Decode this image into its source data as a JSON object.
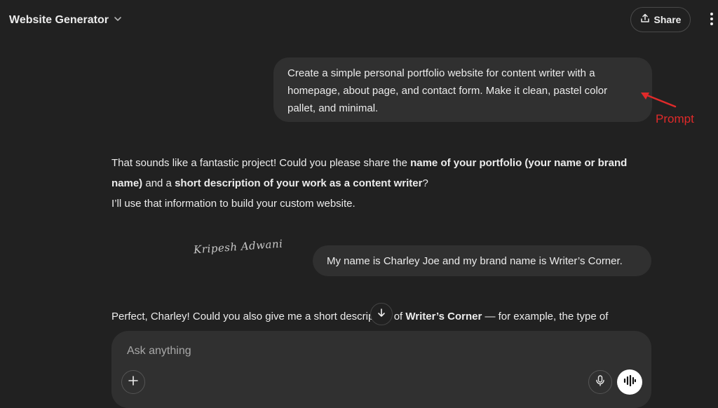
{
  "header": {
    "model_title": "Website Generator",
    "share_label": "Share"
  },
  "conversation": {
    "user_msg_1": "Create a simple personal portfolio website for content writer with a homepage, about page, and contact form. Make it clean, pastel color pallet, and minimal.",
    "annotation_label": "Prompt",
    "assistant_msg_1": {
      "p1_a": "That sounds like a fantastic project! Could you please share the ",
      "p1_b": "name of your portfolio (your name or brand name)",
      "p1_c": " and a ",
      "p1_d": "short description of your work as a content writer",
      "p1_e": "?",
      "p2": "I’ll use that information to build your custom website."
    },
    "signature": "Kripesh Adwani",
    "user_msg_2": "My name is Charley Joe and my brand name is Writer’s Corner.",
    "assistant_msg_2": {
      "a": "Perfect, Charley! Could you also give me a short description of ",
      "b": "Writer’s Corner",
      "c": " — for example, the type of"
    }
  },
  "composer": {
    "placeholder": "Ask anything"
  },
  "colors": {
    "background": "#212121",
    "bubble": "#303030",
    "annotation": "#e02a2a"
  },
  "icons": [
    "chevron-down-icon",
    "share-icon",
    "more-vertical-icon",
    "arrow-down-icon",
    "plus-icon",
    "mic-icon",
    "voice-waveform-icon"
  ]
}
